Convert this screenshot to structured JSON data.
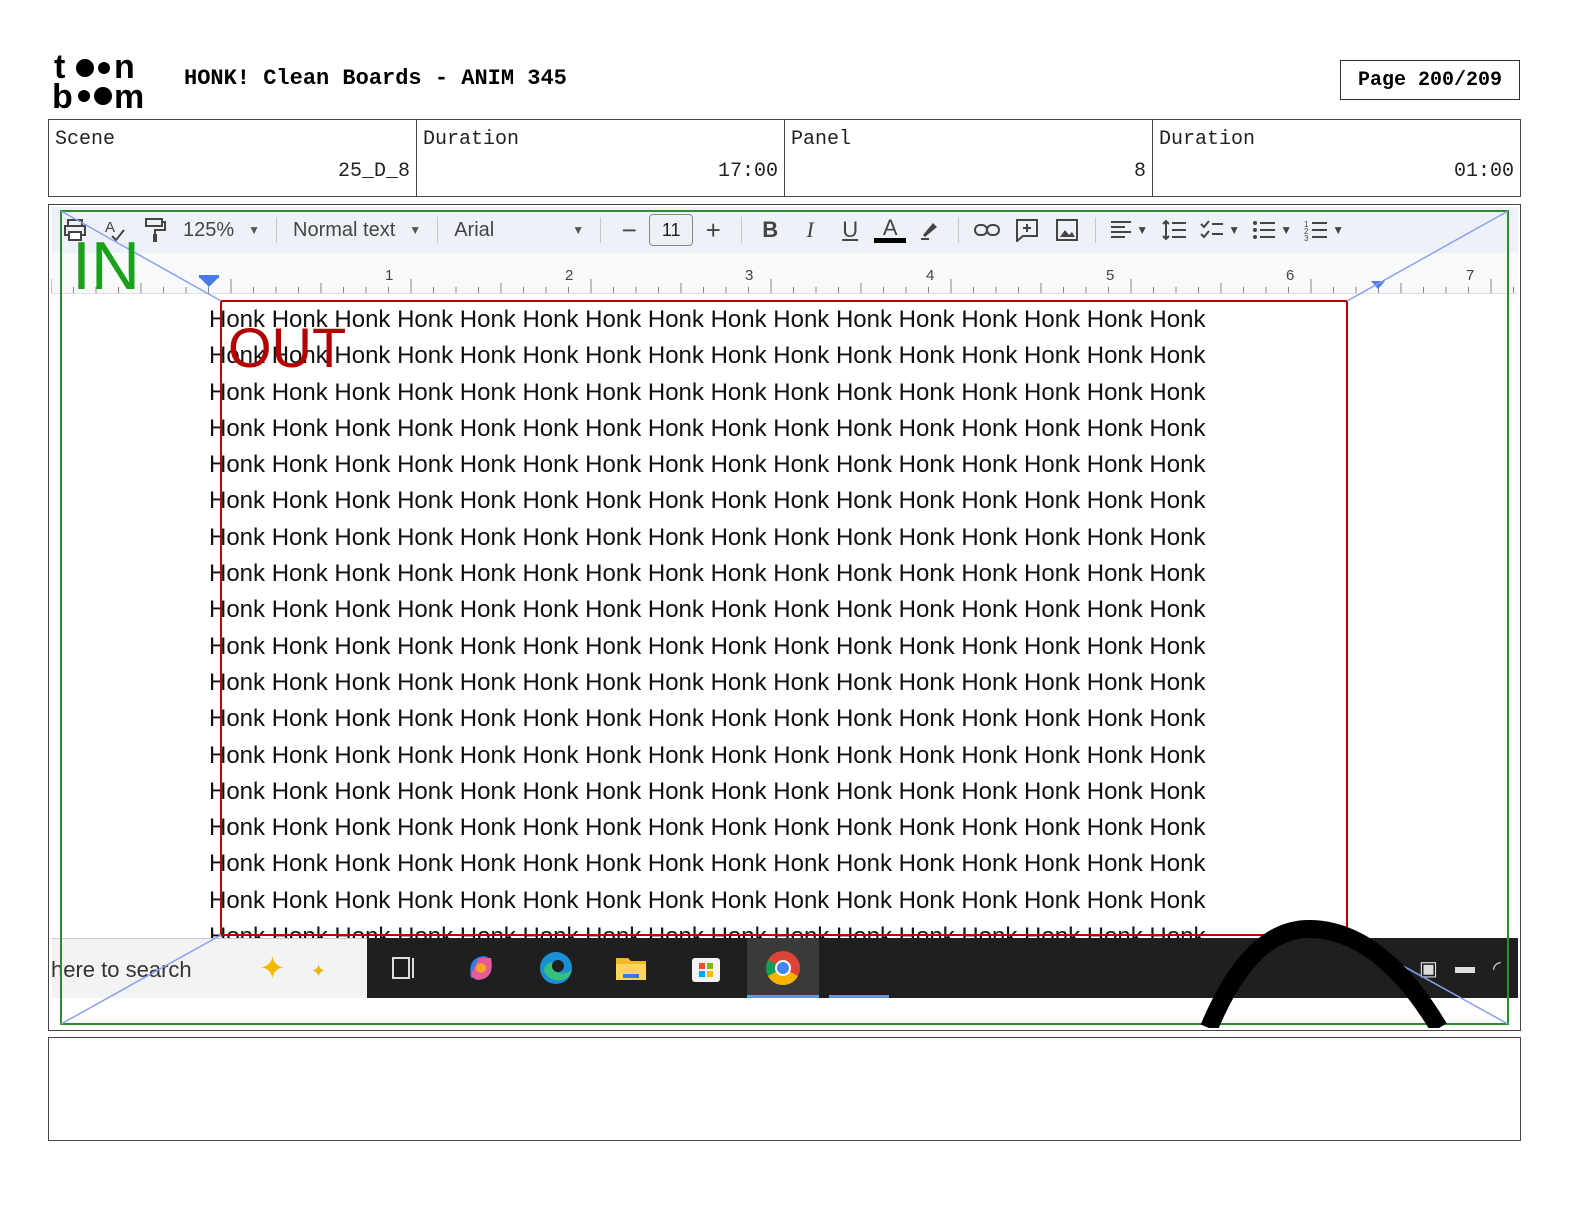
{
  "header": {
    "logo_text": "toon boom",
    "title": "HONK! Clean Boards - ANIM 345",
    "page": "Page 200/209"
  },
  "info": {
    "scene_label": "Scene",
    "scene_value": "25_D_8",
    "duration1_label": "Duration",
    "duration1_value": "17:00",
    "panel_label": "Panel",
    "panel_value": "8",
    "duration2_label": "Duration",
    "duration2_value": "01:00"
  },
  "toolbar": {
    "zoom": "125%",
    "style": "Normal text",
    "font": "Arial",
    "minus": "−",
    "font_size": "11",
    "plus": "+",
    "bold": "B",
    "italic": "I",
    "underline": "U",
    "text_color": "A",
    "icons": [
      "print-icon",
      "spellcheck-icon",
      "paint-format-icon",
      "highlighter-icon",
      "link-icon",
      "comment-icon",
      "image-icon",
      "align-icon",
      "line-spacing-icon",
      "checklist-icon",
      "bullet-list-icon",
      "numbered-list-icon"
    ]
  },
  "ruler": {
    "numbers": [
      "1",
      "2",
      "3",
      "4",
      "5",
      "6",
      "7"
    ]
  },
  "document": {
    "line_text": "Honk Honk Honk Honk Honk Honk Honk Honk Honk Honk Honk Honk Honk Honk Honk Honk",
    "line_count": 18
  },
  "taskbar": {
    "search_text": "here to search",
    "apps": [
      "task-view-icon",
      "copilot-icon",
      "edge-icon",
      "file-explorer-icon",
      "store-icon",
      "chrome-icon"
    ]
  },
  "overlay": {
    "in_label": "IN",
    "out_label": "OUT",
    "in_color": "#1aa01a",
    "out_color": "#b30000"
  }
}
